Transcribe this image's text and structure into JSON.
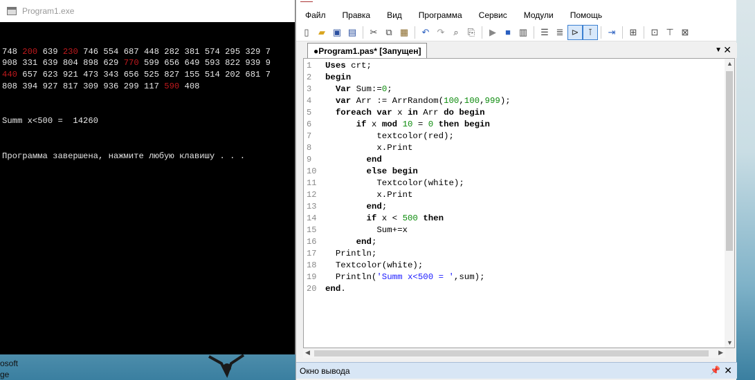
{
  "console": {
    "title": "Program1.exe",
    "lines": [
      [
        [
          "748",
          false
        ],
        [
          "200",
          true
        ],
        [
          "639",
          false
        ],
        [
          "230",
          true
        ],
        [
          "746",
          false
        ],
        [
          "554",
          false
        ],
        [
          "687",
          false
        ],
        [
          "448",
          false
        ],
        [
          "282",
          false
        ],
        [
          "381",
          false
        ],
        [
          "574",
          false
        ],
        [
          "295",
          false
        ],
        [
          "329",
          false
        ],
        [
          "7",
          false
        ]
      ],
      [
        [
          "908",
          false
        ],
        [
          "331",
          false
        ],
        [
          "639",
          false
        ],
        [
          "804",
          false
        ],
        [
          "898",
          false
        ],
        [
          "629",
          false
        ],
        [
          "770",
          true
        ],
        [
          "599",
          false
        ],
        [
          "656",
          false
        ],
        [
          "649",
          false
        ],
        [
          "593",
          false
        ],
        [
          "822",
          false
        ],
        [
          "939",
          false
        ],
        [
          "9",
          false
        ]
      ],
      [
        [
          "440",
          true
        ],
        [
          "657",
          false
        ],
        [
          "623",
          false
        ],
        [
          "921",
          false
        ],
        [
          "473",
          false
        ],
        [
          "343",
          false
        ],
        [
          "656",
          false
        ],
        [
          "525",
          false
        ],
        [
          "827",
          false
        ],
        [
          "155",
          false
        ],
        [
          "514",
          false
        ],
        [
          "202",
          false
        ],
        [
          "681",
          false
        ],
        [
          "7",
          false
        ]
      ],
      [
        [
          "808",
          false
        ],
        [
          "394",
          false
        ],
        [
          "927",
          false
        ],
        [
          "817",
          false
        ],
        [
          "309",
          false
        ],
        [
          "936",
          false
        ],
        [
          "299",
          false
        ],
        [
          "117",
          false
        ],
        [
          "590",
          true
        ],
        [
          "408",
          false
        ]
      ]
    ],
    "summ_line": "Summ x<500 =  14260",
    "end_line": "Программа завершена, нажмите любую клавишу . . ."
  },
  "desktop": {
    "text1": "osoft",
    "text2": "ge"
  },
  "ide": {
    "menu": [
      "Файл",
      "Правка",
      "Вид",
      "Программа",
      "Сервис",
      "Модули",
      "Помощь"
    ],
    "tab_label": "●Program1.pas* [Запущен]",
    "output_label": "Окно вывода",
    "line_numbers": [
      "1",
      "2",
      "3",
      "4",
      "5",
      "6",
      "7",
      "8",
      "9",
      "10",
      "11",
      "12",
      "13",
      "14",
      "15",
      "16",
      "17",
      "18",
      "19",
      "20"
    ],
    "code": [
      [
        [
          "Uses crt;",
          ""
        ]
      ],
      [
        [
          "begin",
          ""
        ]
      ],
      [
        [
          "  Var Sum:=",
          ""
        ],
        [
          "0",
          "n"
        ],
        [
          ";",
          ""
        ]
      ],
      [
        [
          "  var Arr := ArrRandom(",
          ""
        ],
        [
          "100",
          "n"
        ],
        [
          ",",
          ""
        ],
        [
          "100",
          "n"
        ],
        [
          ",",
          ""
        ],
        [
          "999",
          "n"
        ],
        [
          ");",
          ""
        ]
      ],
      [
        [
          "  foreach var x in Arr do begin",
          ""
        ]
      ],
      [
        [
          "      if x mod ",
          ""
        ],
        [
          "10",
          "n"
        ],
        [
          " = ",
          ""
        ],
        [
          "0",
          "n"
        ],
        [
          " then begin",
          ""
        ]
      ],
      [
        [
          "          textcolor(red);",
          ""
        ]
      ],
      [
        [
          "          x.Print",
          ""
        ]
      ],
      [
        [
          "        end",
          ""
        ]
      ],
      [
        [
          "        else begin",
          ""
        ]
      ],
      [
        [
          "          Textcolor(white);",
          ""
        ]
      ],
      [
        [
          "          x.Print",
          ""
        ]
      ],
      [
        [
          "        end;",
          ""
        ]
      ],
      [
        [
          "        if x < ",
          ""
        ],
        [
          "500",
          "n"
        ],
        [
          " then",
          ""
        ]
      ],
      [
        [
          "          Sum+=x",
          ""
        ]
      ],
      [
        [
          "      end;",
          ""
        ]
      ],
      [
        [
          "  Println;",
          ""
        ]
      ],
      [
        [
          "  Textcolor(white);",
          ""
        ]
      ],
      [
        [
          "  Println(",
          ""
        ],
        [
          "'Summ x<500 = '",
          "s"
        ],
        [
          ",sum);",
          ""
        ]
      ],
      [
        [
          "end.",
          ""
        ]
      ]
    ]
  }
}
